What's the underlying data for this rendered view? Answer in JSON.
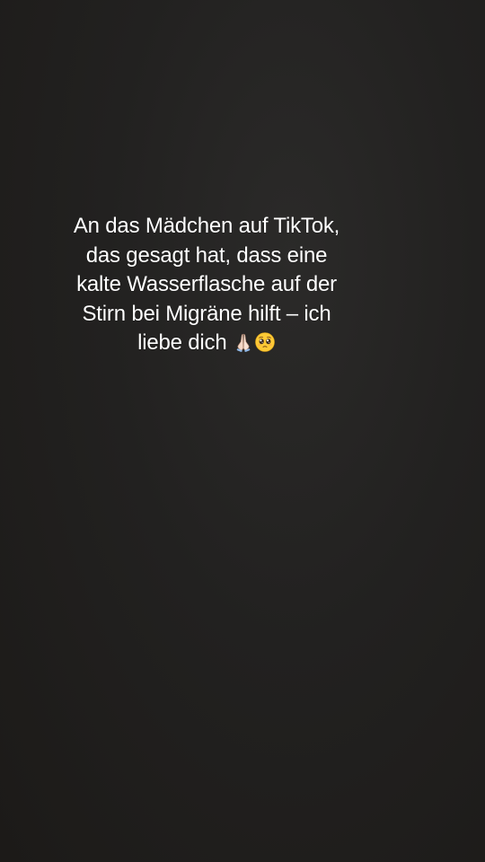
{
  "caption": {
    "lines": [
      "An das Mädchen auf TikTok,",
      "das gesagt hat, dass eine",
      "kalte Wasserflasche auf der",
      "Stirn bei Migräne hilft – ich",
      "liebe dich"
    ],
    "emojis": [
      "folded-hands-icon",
      "pleading-face-icon"
    ]
  },
  "colors": {
    "background": "#232221",
    "text": "#ffffff"
  }
}
